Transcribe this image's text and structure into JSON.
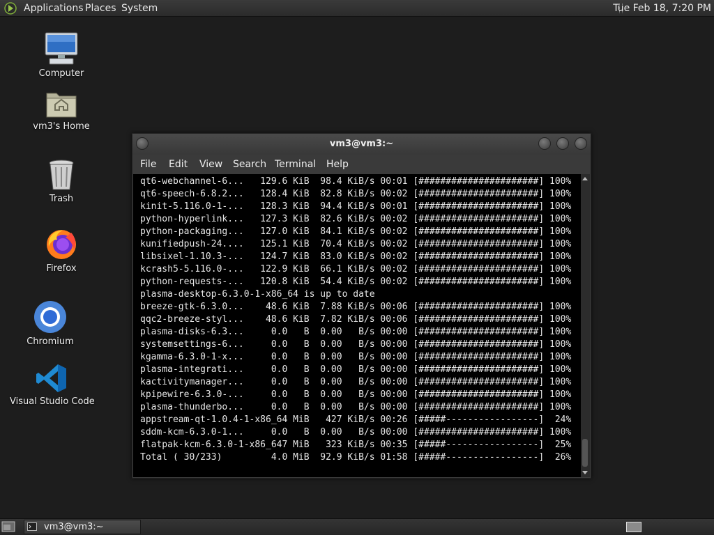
{
  "top_panel": {
    "menus": {
      "applications": "Applications",
      "places": "Places",
      "system": "System"
    },
    "clock": "Tue Feb 18,  7:20 PM"
  },
  "desktop_icons": {
    "computer": "Computer",
    "home": "vm3's Home",
    "trash": "Trash",
    "firefox": "Firefox",
    "chromium": "Chromium",
    "vscode": "Visual Studio Code"
  },
  "terminal": {
    "title": "vm3@vm3:~",
    "menu": {
      "file": "File",
      "edit": "Edit",
      "view": "View",
      "search": "Search",
      "terminal": "Terminal",
      "help": "Help"
    },
    "lines": [
      "qt6-webchannel-6...   129.6 KiB  98.4 KiB/s 00:01 [######################] 100%",
      "qt6-speech-6.8.2...   128.4 KiB  82.8 KiB/s 00:02 [######################] 100%",
      "kinit-5.116.0-1-...   128.3 KiB  94.4 KiB/s 00:01 [######################] 100%",
      "python-hyperlink...   127.3 KiB  82.6 KiB/s 00:02 [######################] 100%",
      "python-packaging...   127.0 KiB  84.1 KiB/s 00:02 [######################] 100%",
      "kunifiedpush-24....   125.1 KiB  70.4 KiB/s 00:02 [######################] 100%",
      "libsixel-1.10.3-...   124.7 KiB  83.0 KiB/s 00:02 [######################] 100%",
      "kcrash5-5.116.0-...   122.9 KiB  66.1 KiB/s 00:02 [######################] 100%",
      "python-requests-...   120.8 KiB  54.4 KiB/s 00:02 [######################] 100%",
      "plasma-desktop-6.3.0-1-x86_64 is up to date",
      "breeze-gtk-6.3.0...    48.6 KiB  7.88 KiB/s 00:06 [######################] 100%",
      "qqc2-breeze-styl...    48.6 KiB  7.82 KiB/s 00:06 [######################] 100%",
      "plasma-disks-6.3...     0.0   B  0.00   B/s 00:00 [######################] 100%",
      "systemsettings-6...     0.0   B  0.00   B/s 00:00 [######################] 100%",
      "kgamma-6.3.0-1-x...     0.0   B  0.00   B/s 00:00 [######################] 100%",
      "plasma-integrati...     0.0   B  0.00   B/s 00:00 [######################] 100%",
      "kactivitymanager...     0.0   B  0.00   B/s 00:00 [######################] 100%",
      "kpipewire-6.3.0-...     0.0   B  0.00   B/s 00:00 [######################] 100%",
      "plasma-thunderbo...     0.0   B  0.00   B/s 00:00 [######################] 100%",
      "appstream-qt-1.0.4-1-x86_64 MiB   427 KiB/s 00:26 [#####-----------------]  24%",
      "sddm-kcm-6.3.0-1...     0.0   B  0.00   B/s 00:00 [######################] 100%",
      "flatpak-kcm-6.3.0-1-x86_647 MiB   323 KiB/s 00:35 [#####-----------------]  25%",
      "Total ( 30/233)         4.0 MiB  92.9 KiB/s 01:58 [#####-----------------]  26%"
    ]
  },
  "bottom_panel": {
    "task_label": "vm3@vm3:~"
  }
}
